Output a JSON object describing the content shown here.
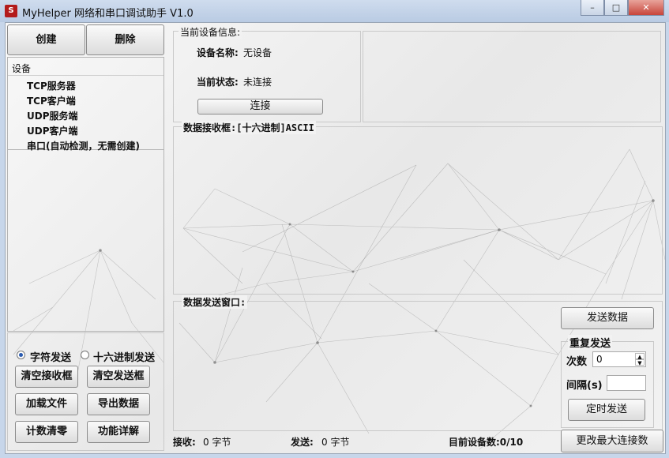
{
  "titlebar": {
    "icon_text": "S",
    "title": "MyHelper 网络和串口调试助手 V1.0"
  },
  "window_buttons": {
    "minimize": "–",
    "maximize": "□",
    "close": "✕"
  },
  "left": {
    "create_label": "创建",
    "delete_label": "删除",
    "tree_header": "设备",
    "tree_items": [
      "TCP服务器",
      "TCP客户端",
      "UDP服务端",
      "UDP客户端",
      "串口(自动检测，无需创建)"
    ]
  },
  "options": {
    "radio_char": "字符发送",
    "radio_hex": "十六进制发送",
    "clear_recv": "清空接收框",
    "clear_send": "清空发送框",
    "load_file": "加载文件",
    "export_data": "导出数据",
    "reset_count": "计数清零",
    "func_detail": "功能详解"
  },
  "device_info": {
    "group_title": "当前设备信息:",
    "name_label": "设备名称:",
    "name_value": "无设备",
    "state_label": "当前状态:",
    "state_value": "未连接",
    "connect_label": "连接"
  },
  "recv": {
    "title": "数据接收框:[十六进制]ASCII"
  },
  "send": {
    "title": "数据发送窗口:",
    "send_btn": "发送数据",
    "repeat_title": "重复发送",
    "count_label": "次数",
    "count_value": "0",
    "interval_label": "间隔(s)",
    "interval_value": "",
    "timer_btn": "定时发送",
    "max_conn_btn": "更改最大连接数"
  },
  "status": {
    "recv_label": "接收:",
    "recv_value": "0 字节",
    "send_label": "发送:",
    "send_value": "0 字节",
    "devices": "目前设备数:0/10"
  }
}
